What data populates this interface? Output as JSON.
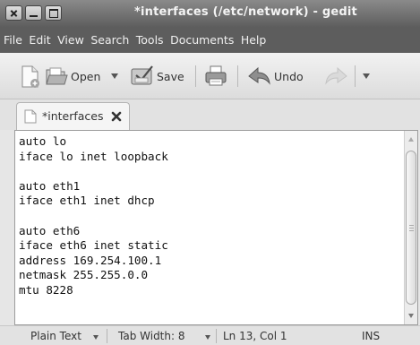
{
  "window": {
    "title": "*interfaces (/etc/network) - gedit"
  },
  "menu": [
    "File",
    "Edit",
    "View",
    "Search",
    "Tools",
    "Documents",
    "Help"
  ],
  "toolbar": {
    "open_label": "Open",
    "save_label": "Save",
    "undo_label": "Undo"
  },
  "tab": {
    "label": "*interfaces"
  },
  "editor": {
    "lines": [
      "auto lo",
      "iface lo inet loopback",
      "",
      "auto eth1",
      "iface eth1 inet dhcp",
      "",
      "auto eth6",
      "iface eth6 inet static",
      "address 169.254.100.1",
      "netmask 255.255.0.0",
      "mtu 8228",
      "",
      ""
    ]
  },
  "statusbar": {
    "language": "Plain Text",
    "tab_width": "Tab Width:  8",
    "cursor": "Ln 13, Col 1",
    "mode": "INS"
  }
}
